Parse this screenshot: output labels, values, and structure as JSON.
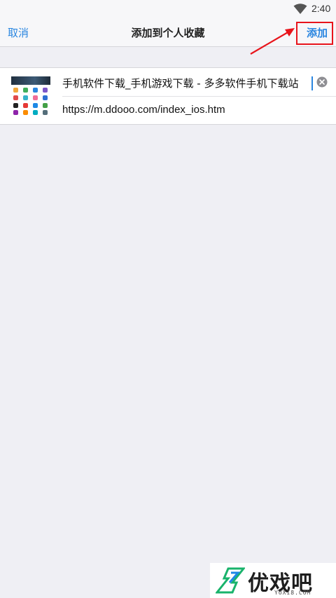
{
  "status_bar": {
    "time": "2:40",
    "wifi_icon": "wifi-icon"
  },
  "nav": {
    "cancel_label": "取消",
    "title": "添加到个人收藏",
    "add_label": "添加"
  },
  "bookmark": {
    "title_value": "手机软件下载_手机游戏下载 - 多多软件手机下载站",
    "url_value": "https://m.ddooo.com/index_ios.htm",
    "thumbnail_icon": "site-thumbnail",
    "clear_icon": "clear-icon"
  },
  "annotation": {
    "highlight_color": "#e8141b",
    "arrow_icon": "red-arrow-icon"
  },
  "watermark": {
    "brand": "优戏吧",
    "sub": "YOXI8.COM"
  },
  "colors": {
    "accent": "#2a86e0",
    "background": "#efeff4"
  }
}
